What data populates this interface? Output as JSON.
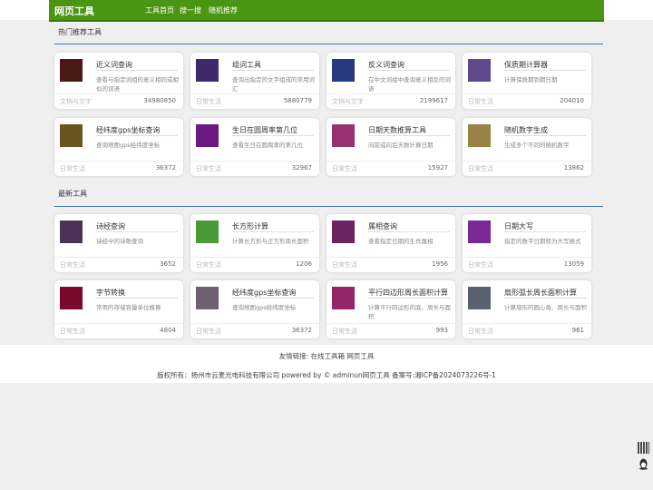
{
  "nav": {
    "logo": "网页工具",
    "links": [
      "工具首页",
      "搜一搜",
      "随机推荐"
    ]
  },
  "sections": [
    {
      "title": "热门推荐工具",
      "cards": [
        {
          "title": "近义词查询",
          "desc": "查看与指定词组的意义相同或相似的词语",
          "category": "文档与文字",
          "count": "34980850",
          "color": "#4b1818"
        },
        {
          "title": "组词工具",
          "desc": "查询出指定的文字组成的常用词汇",
          "category": "日常生活",
          "count": "5880779",
          "color": "#3d2a6b"
        },
        {
          "title": "反义词查询",
          "desc": "在中文词组中查询意义相反的词语",
          "category": "文档与文字",
          "count": "2199617",
          "color": "#263a80"
        },
        {
          "title": "保质期计算器",
          "desc": "计算保质期到期日期",
          "category": "日常生活",
          "count": "204010",
          "color": "#5e4a8a"
        },
        {
          "title": "经纬度gps坐标查询",
          "desc": "查询地图gps经纬度坐标",
          "category": "日常生活",
          "count": "36372",
          "color": "#6b5322"
        },
        {
          "title": "生日在圆周率第几位",
          "desc": "查看生日在圆周率的第几位",
          "category": "日常生活",
          "count": "32967",
          "color": "#6b1a80"
        },
        {
          "title": "日期天数推算工具",
          "desc": "向前或向后天数计算日期",
          "category": "日常生活",
          "count": "15927",
          "color": "#963272"
        },
        {
          "title": "随机数字生成",
          "desc": "生成多个不同的随机数字",
          "category": "日常生活",
          "count": "13862",
          "color": "#9a8245"
        }
      ]
    },
    {
      "title": "最新工具",
      "cards": [
        {
          "title": "诗经查询",
          "desc": "诗经中的诗歌查询",
          "category": "日常生活",
          "count": "3652",
          "color": "#4a3356"
        },
        {
          "title": "长方形计算",
          "desc": "计算长方形与正方形周长面积",
          "category": "日常生活",
          "count": "1206",
          "color": "#4a9a38"
        },
        {
          "title": "属相查询",
          "desc": "查看指定日期的生肖属相",
          "category": "日常生活",
          "count": "1956",
          "color": "#6b2462"
        },
        {
          "title": "日期大写",
          "desc": "指定的数字日期转为大写格式",
          "category": "日常生活",
          "count": "13059",
          "color": "#7a2a96"
        },
        {
          "title": "字节转换",
          "desc": "常用的存储容量单位换算",
          "category": "日常生活",
          "count": "4804",
          "color": "#7a0a2c"
        },
        {
          "title": "经纬度gps坐标查询",
          "desc": "查询地图gps经纬度坐标",
          "category": "日常生活",
          "count": "36372",
          "color": "#6e6070"
        },
        {
          "title": "平行四边形周长面积计算",
          "desc": "计算平行四边形的底、周长与面积",
          "category": "日常生活",
          "count": "993",
          "color": "#962468"
        },
        {
          "title": "扇形弧长周长面积计算",
          "desc": "计算扇形的圆心角、周长与面积",
          "category": "日常生活",
          "count": "961",
          "color": "#5a6270"
        }
      ]
    }
  ],
  "footer": {
    "links": "友情链接: 在线工具箱 网页工具",
    "copyright": "版权所有：扬州市云麦光电科技有限公司 powered by © adminun网页工具 备案号:湘ICP备2024073226号-1"
  },
  "side_icons": [
    "qr-code-icon",
    "qq-penguin-icon"
  ]
}
